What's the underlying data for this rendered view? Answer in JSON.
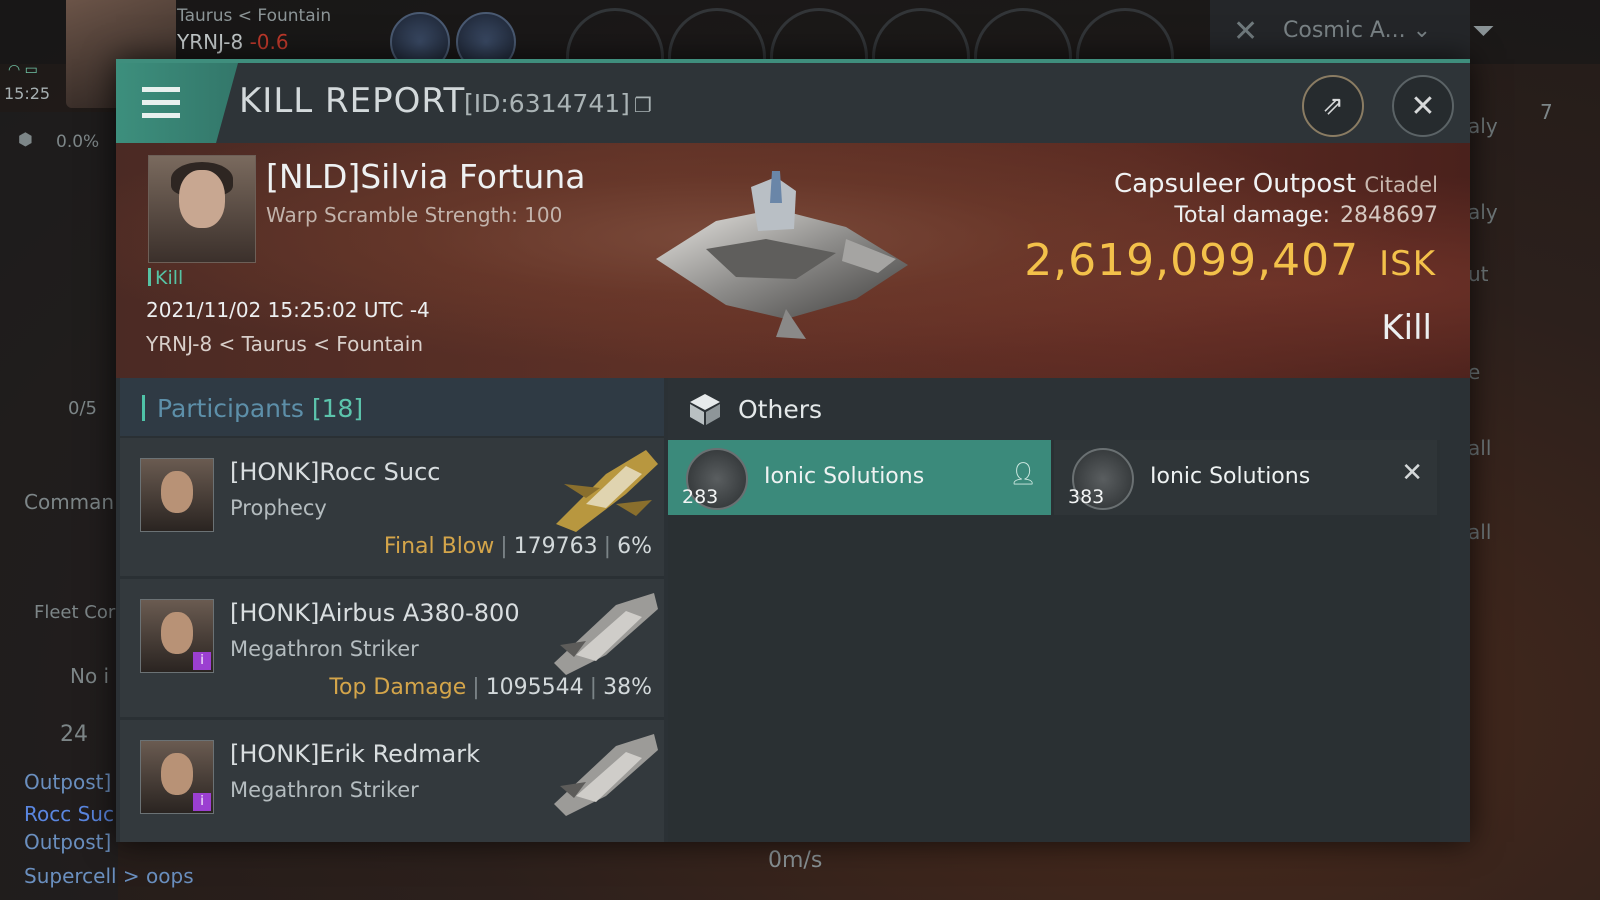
{
  "hud": {
    "region_line": "Taurus  < Fountain",
    "system": "YRNJ-8",
    "security": "-0.6",
    "clock": "15:25",
    "cargo_pct": "0.0%",
    "overview_filter": "Cosmic A...",
    "left_texts": [
      "0/5",
      "Comman",
      "Fleet Cor",
      "No i",
      "24"
    ],
    "chat_lines": [
      "Outpost]",
      "Rocc Suc",
      "Outpost]",
      "Supercell > oops"
    ],
    "right_texts": [
      "aly",
      "aly",
      "ut",
      "e",
      "all",
      "all"
    ],
    "speed": "0m/s",
    "right_badge": "7"
  },
  "report": {
    "title": "KILL REPORT",
    "id_label": "[ID:6314741]"
  },
  "victim": {
    "name": "[NLD]Silvia Fortuna",
    "detail": "Warp Scramble Strength: 100",
    "tag": "Kill",
    "time": "2021/11/02 15:25:02 UTC -4",
    "location": "YRNJ-8 < Taurus < Fountain",
    "ship_name": "Capsuleer Outpost",
    "ship_class": "Citadel",
    "total_damage_label": "Total damage:",
    "total_damage": "2848697",
    "isk_value": "2,619,099,407",
    "isk_unit": "ISK",
    "result": "Kill"
  },
  "participants": {
    "title": "Participants",
    "count": "[18]",
    "rows": [
      {
        "name": "[HONK]Rocc Succ",
        "ship": "Prophecy",
        "role": "Final Blow",
        "damage": "179763",
        "pct": "6%",
        "badge": ""
      },
      {
        "name": "[HONK]Airbus A380-800",
        "ship": "Megathron Striker",
        "role": "Top Damage",
        "damage": "1095544",
        "pct": "38%",
        "badge": "i"
      },
      {
        "name": "[HONK]Erik Redmark",
        "ship": "Megathron Striker",
        "role": "",
        "damage": "",
        "pct": "",
        "badge": "i"
      }
    ]
  },
  "others": {
    "title": "Others",
    "items": [
      {
        "name": "Ionic Solutions",
        "qty": "283",
        "status": "dropped",
        "flag": "person-icon"
      },
      {
        "name": "Ionic Solutions",
        "qty": "383",
        "status": "destroyed",
        "flag": "x-icon"
      }
    ]
  },
  "colors": {
    "accent": "#3f8e7d",
    "isk": "#f3c14a",
    "role": "#d4a54a",
    "dropped": "#3b8a7b"
  }
}
